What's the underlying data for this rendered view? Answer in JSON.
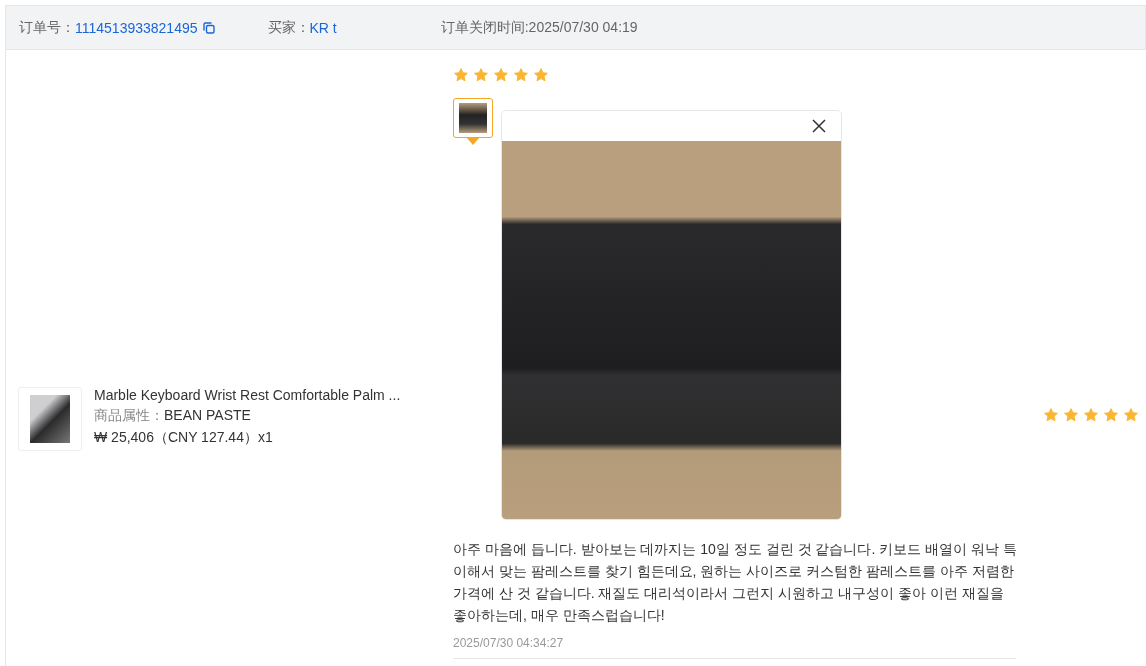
{
  "order_header": {
    "order_no_label": "订单号：",
    "order_no": "1114513933821495",
    "buyer_label": "买家：",
    "buyer": "KR t",
    "closed_time": "订单关闭时间:2025/07/30 04:19"
  },
  "product": {
    "title": "Marble Keyboard Wrist Rest Comfortable Palm ...",
    "attr_label": "商品属性：",
    "attr_value": "BEAN PASTE",
    "price": "₩ 25,406（CNY  127.44）x1"
  },
  "review": {
    "stars": 5,
    "preview_open": true,
    "text": "아주 마음에 듭니다. 받아보는 데까지는 10일 정도 걸린 것 같습니다. 키보드 배열이 워낙 특이해서 맞는 팜레스트를 찾기 힘든데요, 원하는 사이즈로 커스텀한 팜레스트를 아주 저렴한 가격에 산 것 같습니다. 재질도 대리석이라서 그런지 시원하고 내구성이 좋아 이런 재질을 좋아하는데, 매우 만족스럽습니다!",
    "time": "2025/07/30 04:34:27"
  },
  "rating": {
    "stars": 5
  }
}
